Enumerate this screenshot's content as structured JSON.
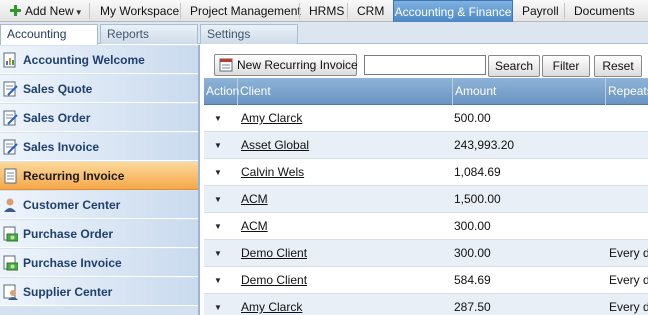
{
  "modules": {
    "add_new": "Add New",
    "items": [
      "My Workspace",
      "Project Management",
      "HRMS",
      "CRM",
      "Accounting & Finance",
      "Payroll",
      "Documents"
    ],
    "active": "Accounting & Finance"
  },
  "subtabs": [
    "Accounting",
    "Reports",
    "Settings"
  ],
  "sidebar": {
    "items": [
      {
        "label": "Accounting Welcome",
        "icon": "document-chart-icon"
      },
      {
        "label": "Sales Quote",
        "icon": "document-edit-icon"
      },
      {
        "label": "Sales Order",
        "icon": "document-edit-icon"
      },
      {
        "label": "Sales Invoice",
        "icon": "document-edit-icon"
      },
      {
        "label": "Recurring Invoice",
        "icon": "document-icon"
      },
      {
        "label": "Customer Center",
        "icon": "customer-icon"
      },
      {
        "label": "Purchase Order",
        "icon": "money-doc-icon"
      },
      {
        "label": "Purchase Invoice",
        "icon": "money-doc-icon"
      },
      {
        "label": "Supplier Center",
        "icon": "supplier-icon"
      }
    ],
    "selected": "Recurring Invoice"
  },
  "toolbar": {
    "new_label": "New Recurring Invoice",
    "search_value": "",
    "search_label": "Search",
    "filter_label": "Filter",
    "reset_label": "Reset"
  },
  "grid": {
    "columns": [
      "Action",
      "Client",
      "Amount",
      "Repeats"
    ],
    "rows": [
      {
        "client": "Amy Clarck",
        "amount": "500.00",
        "repeats": ""
      },
      {
        "client": "Asset Global",
        "amount": "243,993.20",
        "repeats": ""
      },
      {
        "client": "Calvin Wels",
        "amount": "1,084.69",
        "repeats": ""
      },
      {
        "client": "ACM",
        "amount": "1,500.00",
        "repeats": ""
      },
      {
        "client": "ACM",
        "amount": "300.00",
        "repeats": ""
      },
      {
        "client": "Demo Client",
        "amount": "300.00",
        "repeats": "Every d"
      },
      {
        "client": "Demo Client",
        "amount": "584.69",
        "repeats": "Every d"
      },
      {
        "client": "Amy Clarck",
        "amount": "287.50",
        "repeats": "Every d"
      }
    ]
  }
}
